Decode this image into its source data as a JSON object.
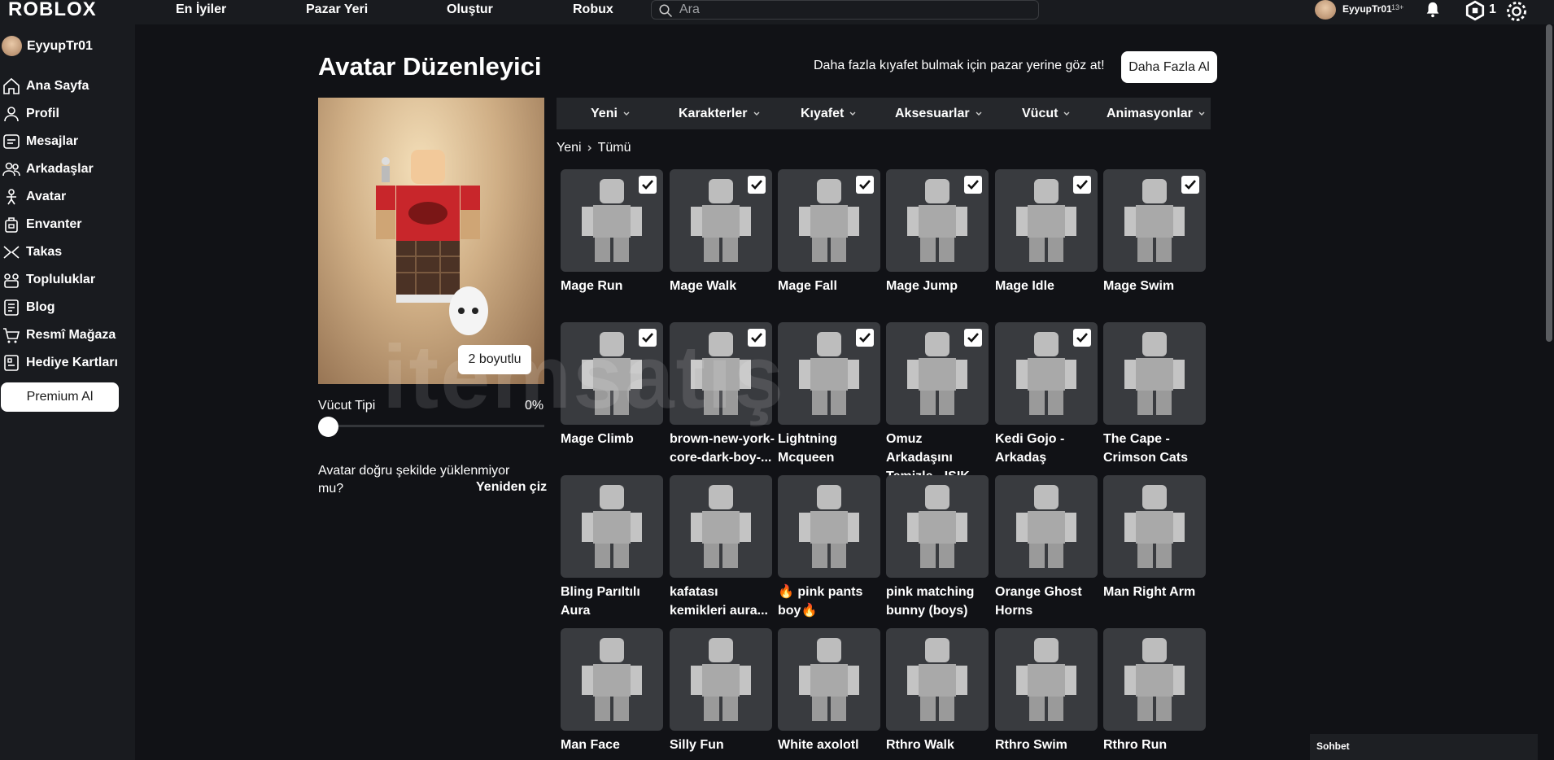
{
  "nav": {
    "logo": "ROBLOX",
    "links": [
      "En İyiler",
      "Pazar Yeri",
      "Oluştur",
      "Robux"
    ],
    "search_placeholder": "Ara",
    "username": "EyyupTr01",
    "age": "13+",
    "robux": "1"
  },
  "sidebar": {
    "username": "EyyupTr01",
    "items": [
      "Ana Sayfa",
      "Profil",
      "Mesajlar",
      "Arkadaşlar",
      "Avatar",
      "Envanter",
      "Takas",
      "Topluluklar",
      "Blog",
      "Resmî Mağaza",
      "Hediye Kartları"
    ],
    "premium": "Premium Al"
  },
  "main": {
    "title": "Avatar Düzenleyici",
    "promo": "Daha fazla kıyafet bulmak için pazar yerine göz at!",
    "get_more": "Daha Fazla Al",
    "two_d": "2 boyutlu",
    "body_type": "Vücut Tipi",
    "body_pct": "0%",
    "issue": "Avatar doğru şekilde yüklenmiyor mu?",
    "redraw": "Yeniden çiz"
  },
  "tabs": [
    "Yeni",
    "Karakterler",
    "Kıyafet",
    "Aksesuarlar",
    "Vücut",
    "Animasyonlar"
  ],
  "breadcrumb": [
    "Yeni",
    "Tümü"
  ],
  "items": [
    {
      "name": "Mage Run",
      "checked": true
    },
    {
      "name": "Mage Walk",
      "checked": true
    },
    {
      "name": "Mage Fall",
      "checked": true
    },
    {
      "name": "Mage Jump",
      "checked": true
    },
    {
      "name": "Mage Idle",
      "checked": true
    },
    {
      "name": "Mage Swim",
      "checked": true
    },
    {
      "name": "Mage Climb",
      "checked": true
    },
    {
      "name": "brown-new-york-core-dark-boy-...",
      "checked": true
    },
    {
      "name": "Lightning Mcqueen",
      "checked": true
    },
    {
      "name": "Omuz Arkadaşını Temizle - IŞIK",
      "checked": true
    },
    {
      "name": "Kedi Gojo - Arkadaş",
      "checked": true
    },
    {
      "name": "The Cape - Crimson Cats",
      "checked": false
    },
    {
      "name": "Bling Parıltılı Aura",
      "checked": false
    },
    {
      "name": "kafatası kemikleri aura...",
      "checked": false
    },
    {
      "name": "🔥 pink pants boy🔥",
      "checked": false
    },
    {
      "name": "pink matching bunny (boys)",
      "checked": false
    },
    {
      "name": "Orange Ghost Horns",
      "checked": false
    },
    {
      "name": "Man Right Arm",
      "checked": false
    },
    {
      "name": "Man Face",
      "checked": false
    },
    {
      "name": "Silly Fun",
      "checked": false
    },
    {
      "name": "White axolotl",
      "checked": false
    },
    {
      "name": "Rthro Walk",
      "checked": false
    },
    {
      "name": "Rthro Swim",
      "checked": false
    },
    {
      "name": "Rthro Run",
      "checked": false
    }
  ],
  "watermark": "itemsatış",
  "chat": "Sohbet",
  "colors": {
    "bg": "#111216",
    "panel": "#191b1f",
    "tile": "#393b3f"
  }
}
